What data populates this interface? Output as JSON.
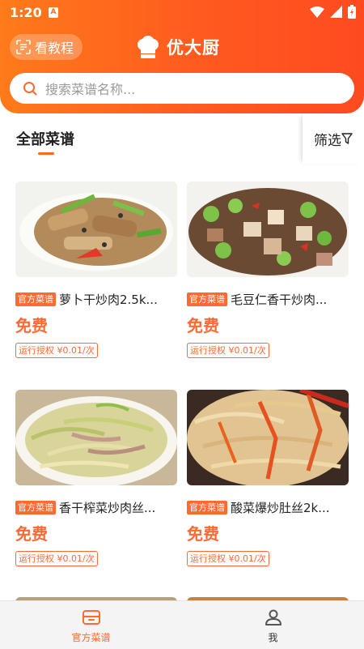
{
  "status_bar": {
    "time": "1:20",
    "app_icon": "A"
  },
  "header": {
    "tutorial_label": "看教程",
    "brand_name": "优大厨",
    "search_placeholder": "搜索菜谱名称..."
  },
  "tabs": {
    "all_label": "全部菜谱",
    "filter_label": "筛选"
  },
  "recipes": [
    {
      "tag": "官方菜谱",
      "title": "萝卜干炒肉2.5k...",
      "price": "免费",
      "auth": "运行授权 ¥0.01/次"
    },
    {
      "tag": "官方菜谱",
      "title": "毛豆仁香干炒肉...",
      "price": "免费",
      "auth": "运行授权 ¥0.01/次"
    },
    {
      "tag": "官方菜谱",
      "title": "香干榨菜炒肉丝...",
      "price": "免费",
      "auth": "运行授权 ¥0.01/次"
    },
    {
      "tag": "官方菜谱",
      "title": "酸菜爆炒肚丝2k...",
      "price": "免费",
      "auth": "运行授权 ¥0.01/次"
    }
  ],
  "bottom_nav": [
    {
      "label": "官方菜谱",
      "icon": "recipe-box-icon",
      "active": true
    },
    {
      "label": "我",
      "icon": "user-icon",
      "active": false
    }
  ],
  "colors": {
    "accent": "#ff6a33",
    "header_start": "#ff7a1a",
    "header_end": "#ff4a20"
  }
}
